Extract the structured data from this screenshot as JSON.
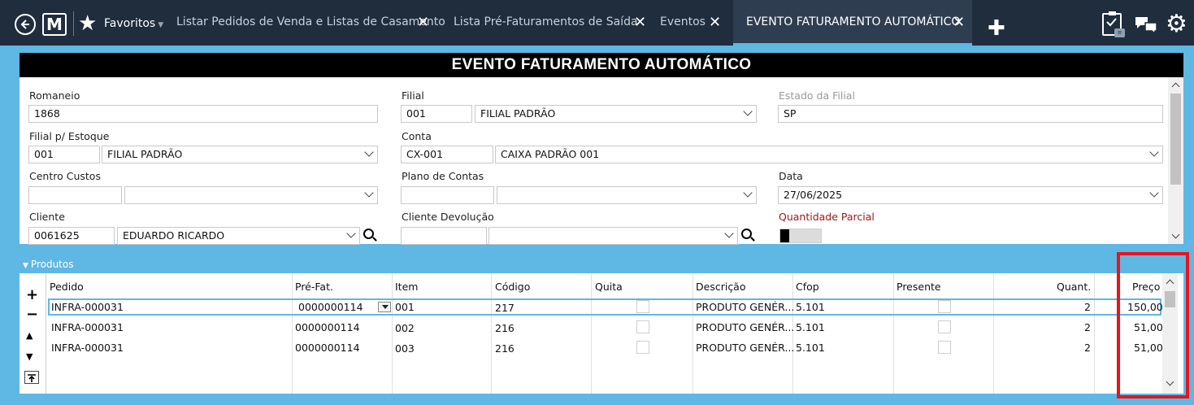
{
  "topbar": {
    "favorites_label": "Favoritos",
    "tabs": [
      {
        "label": "Listar Pedidos de Venda e Listas de Casamento"
      },
      {
        "label": "Lista Pré-Faturamentos de Saída"
      },
      {
        "label": "Eventos"
      },
      {
        "label": "EVENTO FATURAMENTO AUTOMÁTICO",
        "active": true
      }
    ],
    "icons": [
      "back-icon",
      "logo-icon",
      "star-icon",
      "plus-icon",
      "clipboard-icon",
      "chat-icon",
      "gear-icon"
    ]
  },
  "page": {
    "title": "EVENTO FATURAMENTO AUTOMÁTICO"
  },
  "form": {
    "romaneio": {
      "label": "Romaneio",
      "value": "1868"
    },
    "filial": {
      "label": "Filial",
      "code": "001",
      "name": "FILIAL PADRÃO"
    },
    "estado_filial": {
      "label": "Estado da Filial",
      "value": "SP"
    },
    "filial_estoque": {
      "label": "Filial p/ Estoque",
      "code": "001",
      "name": "FILIAL PADRÃO"
    },
    "conta": {
      "label": "Conta",
      "code": "CX-001",
      "name": "CAIXA PADRÃO 001"
    },
    "centro_custos": {
      "label": "Centro Custos",
      "code": "",
      "name": ""
    },
    "plano_contas": {
      "label": "Plano de Contas",
      "code": "",
      "name": ""
    },
    "data": {
      "label": "Data",
      "value": "27/06/2025"
    },
    "cliente": {
      "label": "Cliente",
      "code": "0061625",
      "name": "EDUARDO RICARDO"
    },
    "cliente_devolucao": {
      "label": "Cliente Devolução",
      "code": "",
      "name": ""
    },
    "quantidade_parcial": {
      "label": "Quantidade Parcial",
      "on": false
    }
  },
  "produtos": {
    "section_label": "Produtos",
    "columns": [
      "Pedido",
      "Pré-Fat.",
      "Item",
      "Código",
      "Quita",
      "Descrição",
      "Cfop",
      "Presente",
      "Quant.",
      "Preço"
    ],
    "rows": [
      {
        "pedido": "INFRA-000031",
        "prefat": "0000000114",
        "item": "001",
        "codigo": "217",
        "quita": false,
        "descricao": "PRODUTO GENÉR...",
        "cfop": "5.101",
        "presente": false,
        "quant": "2",
        "preco": "150,00"
      },
      {
        "pedido": "INFRA-000031",
        "prefat": "0000000114",
        "item": "002",
        "codigo": "216",
        "quita": false,
        "descricao": "PRODUTO GENÉR...",
        "cfop": "5.101",
        "presente": false,
        "quant": "2",
        "preco": "51,00"
      },
      {
        "pedido": "INFRA-000031",
        "prefat": "0000000114",
        "item": "003",
        "codigo": "216",
        "quita": false,
        "descricao": "PRODUTO GENÉR...",
        "cfop": "5.101",
        "presente": false,
        "quant": "2",
        "preco": "51,00"
      }
    ],
    "tools": [
      "add",
      "remove",
      "move-up",
      "move-down",
      "export"
    ]
  },
  "colors": {
    "topbar": "#1f2d3d",
    "frame": "#5fb7e4",
    "header": "#000000",
    "highlight_box": "#e8141c",
    "label_red": "#a01818"
  }
}
